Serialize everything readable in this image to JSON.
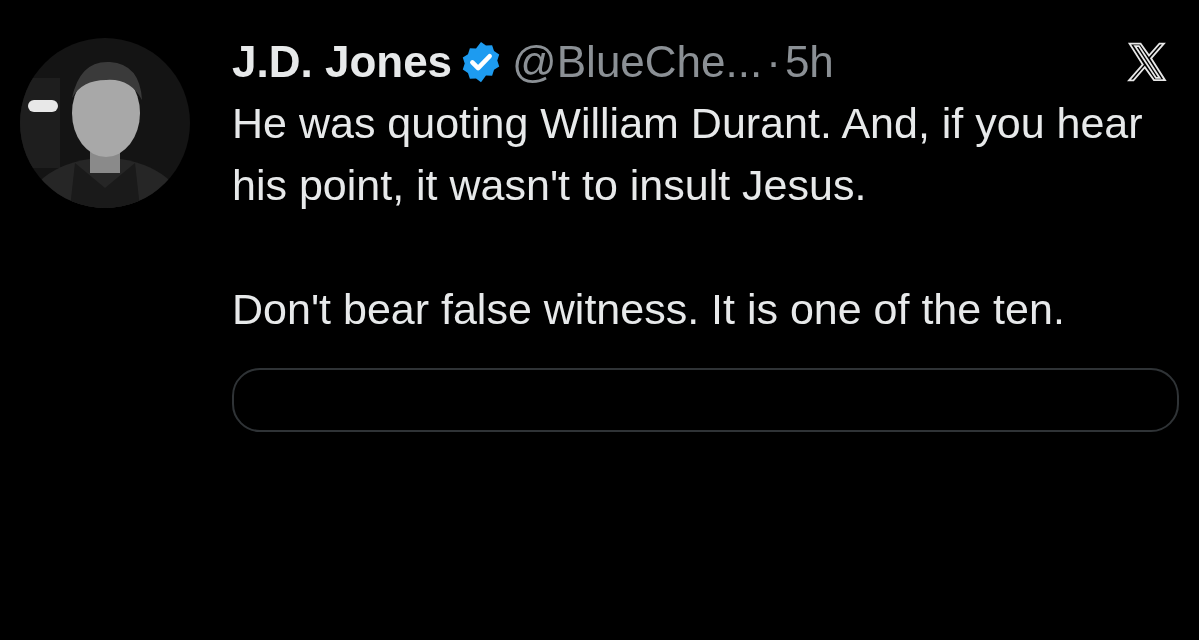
{
  "tweet": {
    "author": {
      "name": "J.D. Jones",
      "verified": true,
      "handle": "@BlueChe...",
      "separator": "·",
      "time": "5h"
    },
    "paragraphs": [
      "He was quoting William Durant. And, if you hear his point, it wasn't to insult Jesus.",
      "Don't bear false witness. It is one of the ten."
    ]
  }
}
